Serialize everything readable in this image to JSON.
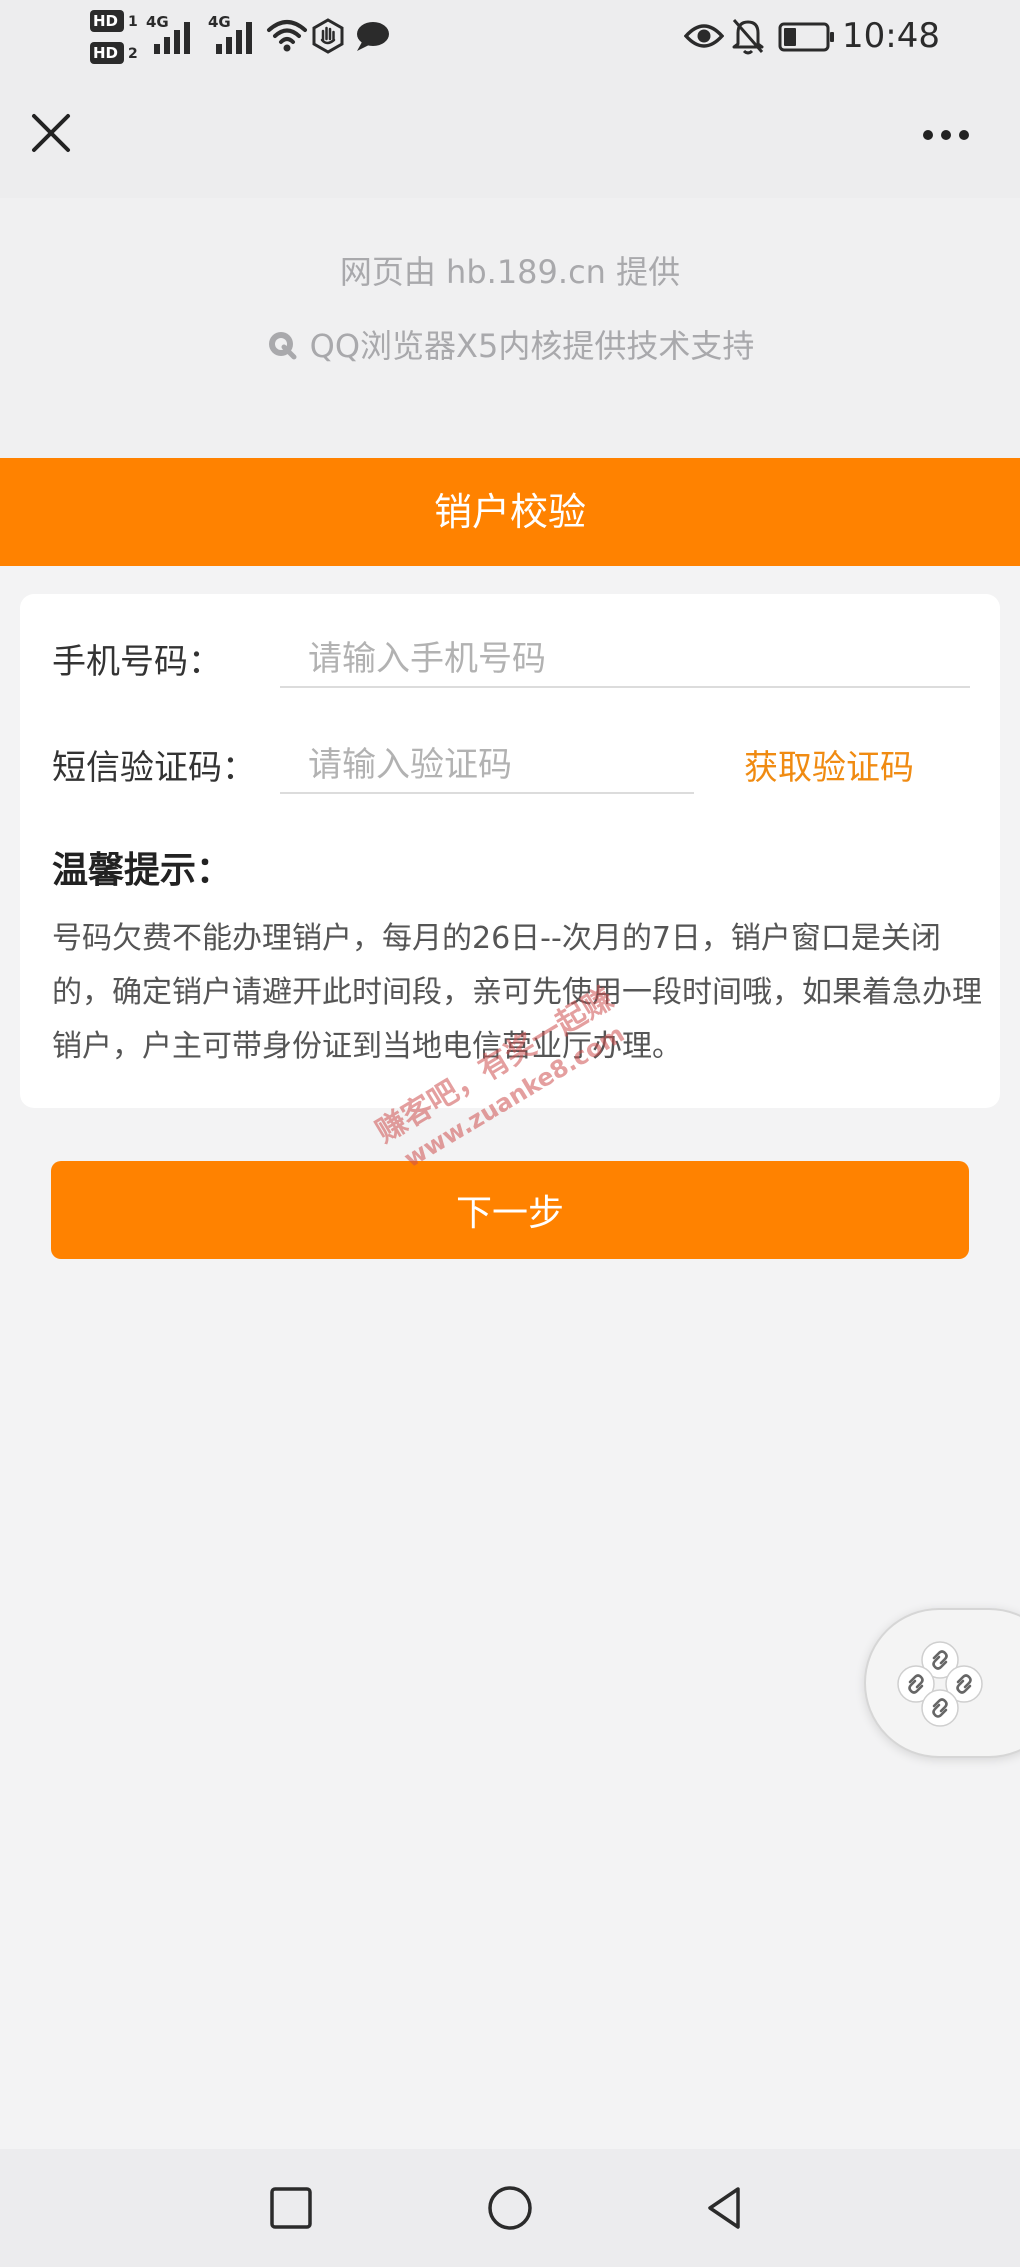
{
  "status_bar": {
    "time": "10:48",
    "hd1": {
      "label": "HD",
      "sim": "1"
    },
    "hd2": {
      "label": "HD",
      "sim": "2"
    },
    "network_1": "4G",
    "network_2": "4G",
    "battery_level": 0.3,
    "icons": [
      "signal-icon",
      "wifi-icon",
      "hand-icon",
      "chat-icon",
      "eye-icon",
      "bell-off-icon",
      "battery-icon"
    ]
  },
  "title_bar": {
    "close_icon": "close-icon",
    "more_icon": "more-icon"
  },
  "provider": {
    "line1": "网页由 hb.189.cn 提供",
    "line2": "QQ浏览器X5内核提供技术支持"
  },
  "header": {
    "title": "销户校验"
  },
  "form": {
    "phone_label": "手机号码：",
    "phone_placeholder": "请输入手机号码",
    "phone_value": "",
    "sms_label": "短信验证码：",
    "sms_placeholder": "请输入验证码",
    "sms_value": "",
    "get_code_label": "获取验证码"
  },
  "tips": {
    "title": "温馨提示：",
    "body": "号码欠费不能办理销户，每月的26日--次月的7日，销户窗口是关闭的，确定销户请避开此时间段，亲可先使用一段时间哦，如果着急办理销户，户主可带身份证到当地电信营业厅办理。"
  },
  "next_button": {
    "label": "下一步"
  },
  "watermark": {
    "line1": "赚客吧，有奖一起赚",
    "line2": "www.zuanke8.com"
  },
  "nav_bar": {
    "icons": [
      "recent-apps-icon",
      "home-icon",
      "back-icon"
    ]
  },
  "colors": {
    "accent": "#ff8200",
    "link": "#f08b12",
    "page_bg": "#f3f3f4"
  }
}
